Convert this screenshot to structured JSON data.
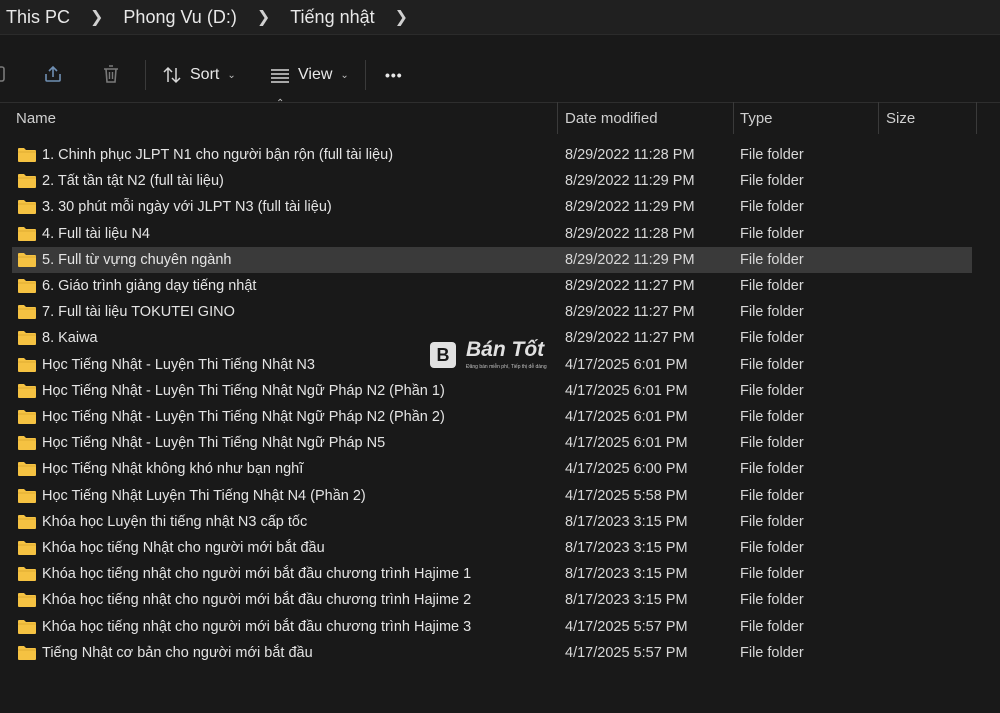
{
  "breadcrumb": [
    "This PC",
    "Phong Vu (D:)",
    "Tiếng nhật"
  ],
  "toolbar": {
    "sort_label": "Sort",
    "view_label": "View",
    "more_label": "•••"
  },
  "columns": {
    "name": "Name",
    "date": "Date modified",
    "type": "Type",
    "size": "Size"
  },
  "rows": [
    {
      "name": "1. Chinh phục JLPT N1 cho người bận rộn (full tài liệu)",
      "date": "8/29/2022 11:28 PM",
      "type": "File folder"
    },
    {
      "name": "2. Tất tần tật N2 (full tài liệu)",
      "date": "8/29/2022 11:29 PM",
      "type": "File folder"
    },
    {
      "name": "3. 30 phút mỗi ngày với JLPT N3 (full tài liệu)",
      "date": "8/29/2022 11:29 PM",
      "type": "File folder"
    },
    {
      "name": "4. Full tài liệu N4",
      "date": "8/29/2022 11:28 PM",
      "type": "File folder"
    },
    {
      "name": "5. Full từ vựng chuyên ngành",
      "date": "8/29/2022 11:29 PM",
      "type": "File folder",
      "selected": true
    },
    {
      "name": "6. Giáo trình giảng dạy tiếng nhật",
      "date": "8/29/2022 11:27 PM",
      "type": "File folder"
    },
    {
      "name": "7. Full tài liệu TOKUTEI GINO",
      "date": "8/29/2022 11:27 PM",
      "type": "File folder"
    },
    {
      "name": "8. Kaiwa",
      "date": "8/29/2022 11:27 PM",
      "type": "File folder"
    },
    {
      "name": "Học Tiếng Nhật - Luyện Thi Tiếng Nhật N3",
      "date": "4/17/2025 6:01 PM",
      "type": "File folder"
    },
    {
      "name": "Học Tiếng Nhật - Luyện Thi Tiếng Nhật Ngữ Pháp N2 (Phần 1)",
      "date": "4/17/2025 6:01 PM",
      "type": "File folder"
    },
    {
      "name": "Học Tiếng Nhật - Luyện Thi Tiếng Nhật Ngữ Pháp N2 (Phần 2)",
      "date": "4/17/2025 6:01 PM",
      "type": "File folder"
    },
    {
      "name": "Học Tiếng Nhật - Luyện Thi Tiếng Nhật Ngữ Pháp N5",
      "date": "4/17/2025 6:01 PM",
      "type": "File folder"
    },
    {
      "name": "Học Tiếng Nhật không khó như bạn nghĩ",
      "date": "4/17/2025 6:00 PM",
      "type": "File folder"
    },
    {
      "name": "Học Tiếng Nhật Luyện Thi Tiếng Nhật N4 (Phần 2)",
      "date": "4/17/2025 5:58 PM",
      "type": "File folder"
    },
    {
      "name": "Khóa học Luyện thi tiếng nhật N3 cấp tốc",
      "date": "8/17/2023 3:15 PM",
      "type": "File folder"
    },
    {
      "name": "Khóa học tiếng Nhật cho người mới bắt đầu",
      "date": "8/17/2023 3:15 PM",
      "type": "File folder"
    },
    {
      "name": "Khóa học tiếng nhật cho người mới bắt đầu chương trình Hajime 1",
      "date": "8/17/2023 3:15 PM",
      "type": "File folder"
    },
    {
      "name": "Khóa học tiếng nhật cho người mới bắt đầu chương trình Hajime 2",
      "date": "8/17/2023 3:15 PM",
      "type": "File folder"
    },
    {
      "name": "Khóa học tiếng nhật cho người mới bắt đầu chương trình Hajime 3",
      "date": "4/17/2025 5:57 PM",
      "type": "File folder"
    },
    {
      "name": "Tiếng Nhật cơ bản cho người mới bắt đầu",
      "date": "4/17/2025 5:57 PM",
      "type": "File folder"
    }
  ],
  "watermark": {
    "logo": "B",
    "brand": "Bán Tốt",
    "tagline": "Đăng bán miễn phí, Tiếp thị dễ dàng"
  },
  "colors": {
    "background": "#191919",
    "selected_row": "#3a3a3a",
    "folder": "#f5c242"
  }
}
